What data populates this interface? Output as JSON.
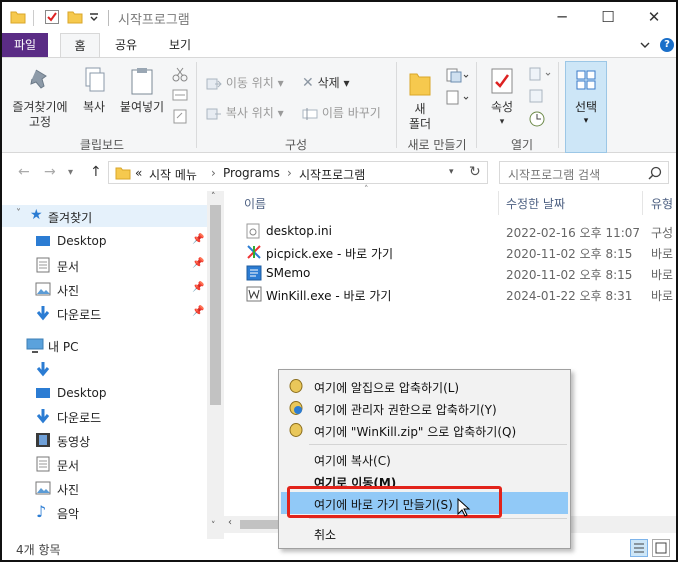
{
  "window": {
    "title": "시작프로그램",
    "controls": {
      "minimize": "─",
      "maximize": "☐",
      "close": "✕"
    }
  },
  "ribbon_tabs": {
    "file": "파일",
    "home": "홈",
    "share": "공유",
    "view": "보기"
  },
  "ribbon": {
    "clipboard": {
      "label": "클립보드",
      "pin": "즐겨찾기에\n고정",
      "pin_line1": "즐겨찾기에",
      "pin_line2": "고정",
      "copy": "복사",
      "paste": "붙여넣기"
    },
    "organize": {
      "label": "구성",
      "move_to": "이동 위치",
      "copy_to": "복사 위치",
      "delete": "삭제",
      "rename": "이름 바꾸기"
    },
    "new": {
      "label": "새로 만들기",
      "new_folder_line1": "새",
      "new_folder_line2": "폴더"
    },
    "open": {
      "label": "열기",
      "properties": "속성"
    },
    "select": {
      "label": "선택"
    }
  },
  "address": {
    "prefix": "«",
    "parts": [
      "시작 메뉴",
      "Programs",
      "시작프로그램"
    ],
    "sep": "›",
    "search_placeholder": "시작프로그램 검색"
  },
  "nav_pane": {
    "items": [
      {
        "label": "즐겨찾기",
        "icon": "star-icon",
        "selected": true
      },
      {
        "label": "Desktop",
        "icon": "desktop-icon",
        "pinned": true
      },
      {
        "label": "문서",
        "icon": "document-icon",
        "pinned": true
      },
      {
        "label": "사진",
        "icon": "picture-icon",
        "pinned": true
      },
      {
        "label": "다운로드",
        "icon": "download-icon",
        "pinned": true
      },
      {
        "label": "내 PC",
        "icon": "pc-icon"
      },
      {
        "label": "",
        "icon": "download-icon"
      },
      {
        "label": "Desktop",
        "icon": "desktop-icon"
      },
      {
        "label": "다운로드",
        "icon": "download-icon"
      },
      {
        "label": "동영상",
        "icon": "video-icon"
      },
      {
        "label": "문서",
        "icon": "document-icon"
      },
      {
        "label": "사진",
        "icon": "picture-icon"
      },
      {
        "label": "음악",
        "icon": "music-icon"
      }
    ]
  },
  "columns": {
    "name": "이름",
    "date": "수정한 날짜",
    "type": "유형"
  },
  "files": [
    {
      "name": "desktop.ini",
      "date": "2022-02-16 오후 11:07",
      "type": "구성",
      "icon": "ini-file-icon"
    },
    {
      "name": "picpick.exe - 바로 가기",
      "date": "2020-11-02 오후 8:15",
      "type": "바로",
      "icon": "picpick-shortcut-icon"
    },
    {
      "name": "SMemo",
      "date": "2020-11-02 오후 8:15",
      "type": "바로",
      "icon": "smemo-shortcut-icon"
    },
    {
      "name": "WinKill.exe - 바로 가기",
      "date": "2024-01-22 오후 8:31",
      "type": "바로",
      "icon": "winkill-shortcut-icon"
    }
  ],
  "context_menu": {
    "items": [
      {
        "label": "여기에 알집으로 압축하기(L)"
      },
      {
        "label": "여기에 관리자 권한으로 압축하기(Y)"
      },
      {
        "label": "여기에 \"WinKill.zip\" 으로 압축하기(Q)"
      },
      {
        "label": "여기에 복사(C)"
      },
      {
        "label": "여기로 이동(M)"
      },
      {
        "label": "여기에 바로 가기 만들기(S)"
      },
      {
        "label": "취소"
      }
    ],
    "highlighted_index": 5
  },
  "status_bar": {
    "item_count": "4개 항목"
  },
  "colors": {
    "file_tab": "#5a2c85",
    "highlight": "#91c9f7",
    "annotation": "#e2231a",
    "selected_nav": "#e5f1fb"
  }
}
